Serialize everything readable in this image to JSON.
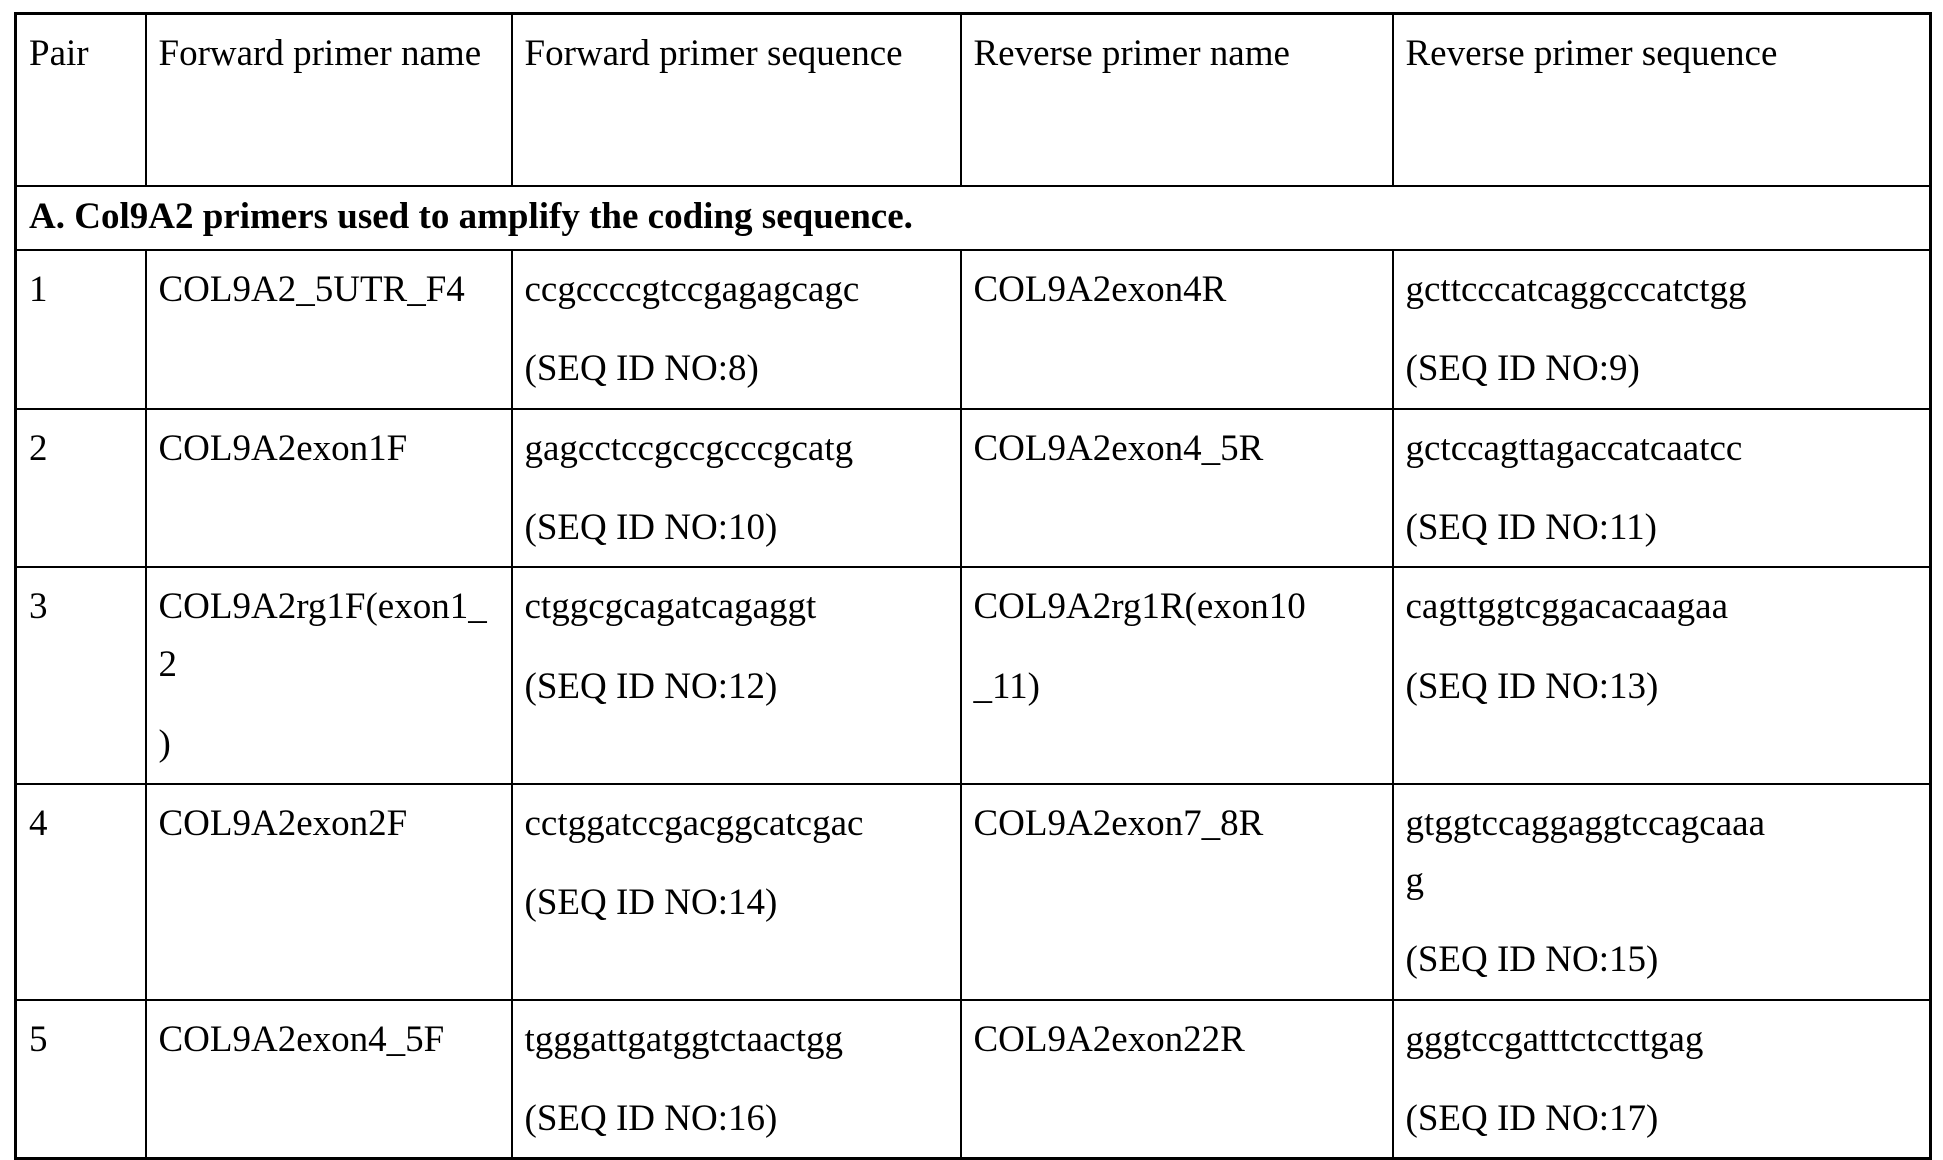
{
  "table": {
    "columns": [
      {
        "key": "pair",
        "label": "Pair"
      },
      {
        "key": "forward_name",
        "label": "Forward primer name"
      },
      {
        "key": "forward_sequence",
        "label": "Forward primer sequence"
      },
      {
        "key": "reverse_name",
        "label": "Reverse primer name"
      },
      {
        "key": "reverse_sequence",
        "label": "Reverse primer sequence"
      }
    ],
    "section": {
      "label": "A. Col9A2 primers used to amplify the coding sequence."
    },
    "rows": [
      {
        "pair": "1",
        "forward_name": "COL9A2_5UTR_F4",
        "forward_name_line2": "",
        "forward_sequence": "ccgccccgtccgagagcagc",
        "forward_sequence_line2": "",
        "forward_seq_id": "(SEQ ID NO:8)",
        "reverse_name": "COL9A2exon4R",
        "reverse_name_line2": "",
        "reverse_sequence": "gcttcccatcaggcccatctgg",
        "reverse_sequence_line2": "",
        "reverse_seq_id": "(SEQ ID NO:9)"
      },
      {
        "pair": "2",
        "forward_name": "COL9A2exon1F",
        "forward_name_line2": "",
        "forward_sequence": "gagcctccgccgcccgcatg",
        "forward_sequence_line2": "",
        "forward_seq_id": "(SEQ ID NO:10)",
        "reverse_name": "COL9A2exon4_5R",
        "reverse_name_line2": "",
        "reverse_sequence": "gctccagttagaccatcaatcc",
        "reverse_sequence_line2": "",
        "reverse_seq_id": "(SEQ ID NO:11)"
      },
      {
        "pair": "3",
        "forward_name": "COL9A2rg1F(exon1_2",
        "forward_name_line2": ")",
        "forward_sequence": "ctggcgcagatcagaggt",
        "forward_sequence_line2": "",
        "forward_seq_id": "(SEQ ID NO:12)",
        "reverse_name": "COL9A2rg1R(exon10",
        "reverse_name_line2": "_11)",
        "reverse_sequence": "cagttggtcggacacaagaa",
        "reverse_sequence_line2": "",
        "reverse_seq_id": "(SEQ ID NO:13)"
      },
      {
        "pair": "4",
        "forward_name": "COL9A2exon2F",
        "forward_name_line2": "",
        "forward_sequence": "cctggatccgacggcatcgac",
        "forward_sequence_line2": "",
        "forward_seq_id": "(SEQ ID NO:14)",
        "reverse_name": "COL9A2exon7_8R",
        "reverse_name_line2": "",
        "reverse_sequence": "gtggtccaggaggtccagcaaa",
        "reverse_sequence_line2": "g",
        "reverse_seq_id": "(SEQ ID NO:15)"
      },
      {
        "pair": "5",
        "forward_name": "COL9A2exon4_5F",
        "forward_name_line2": "",
        "forward_sequence": "tgggattgatggtctaactgg",
        "forward_sequence_line2": "",
        "forward_seq_id": "(SEQ ID NO:16)",
        "reverse_name": "COL9A2exon22R",
        "reverse_name_line2": "",
        "reverse_sequence": "gggtccgatttctccttgag",
        "reverse_sequence_line2": "",
        "reverse_seq_id": "(SEQ ID NO:17)"
      }
    ]
  }
}
